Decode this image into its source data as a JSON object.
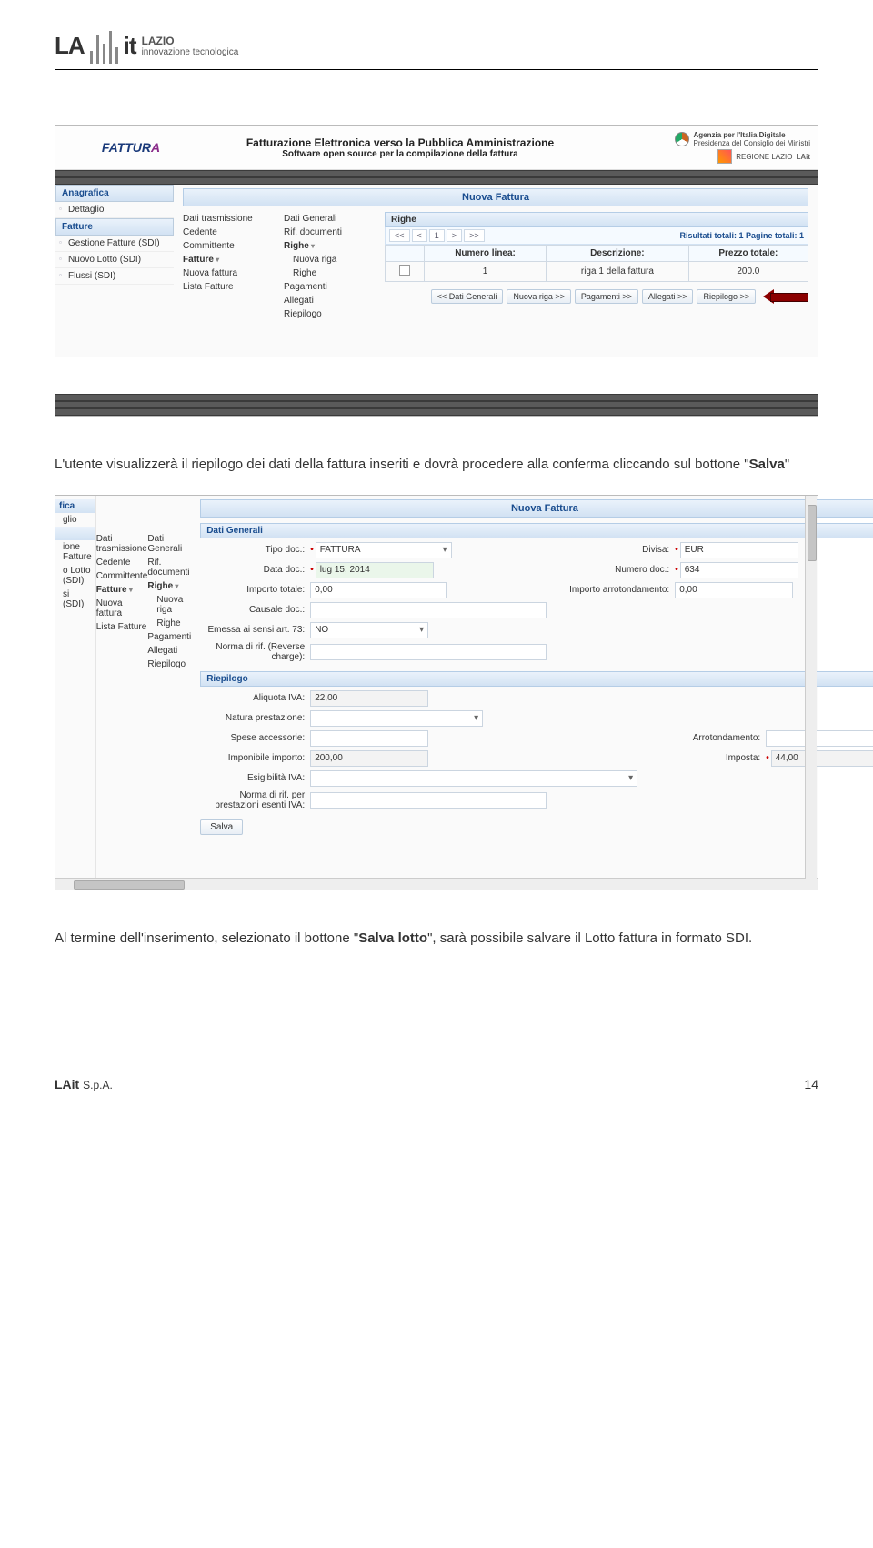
{
  "header": {
    "brand": "LA",
    "brand2": "it",
    "region": "LAZIO",
    "tagline": "innovazione tecnologica"
  },
  "text": {
    "para1": "L'utente visualizzerà il riepilogo dei dati della fattura inseriti e dovrà procedere alla conferma cliccando sul bottone \"",
    "para1_bold": "Salva",
    "para1_end": "\"",
    "para2a": "Al termine dell'inserimento, selezionato il bottone \"",
    "para2_bold": "Salva lotto",
    "para2b": "\", sarà possibile salvare il Lotto fattura in formato SDI."
  },
  "shot1": {
    "headerTitle": "Fatturazione Elettronica verso la Pubblica Amministrazione",
    "headerSub": "Software open source per la compilazione della fattura",
    "agid": "Agenzia per l'Italia Digitale",
    "agidSub": "Presidenza del Consiglio dei Ministri",
    "regione": "REGIONE LAZIO",
    "lait": "LAit",
    "sidebar": {
      "s1": "Anagrafica",
      "s1_items": [
        "Dettaglio"
      ],
      "s2": "Fatture",
      "s2_items": [
        "Gestione Fatture (SDI)",
        "Nuovo Lotto (SDI)",
        "Flussi (SDI)"
      ]
    },
    "subnav1": [
      "Dati trasmissione",
      "Cedente",
      "Committente",
      "Fatture",
      "Nuova fattura",
      "Lista Fatture"
    ],
    "subnav2": [
      "Dati Generali",
      "Rif. documenti",
      "Righe",
      "Nuova riga",
      "Righe",
      "Pagamenti",
      "Allegati",
      "Riepilogo"
    ],
    "panelTitle": "Nuova Fattura",
    "righeTitle": "Righe",
    "pager": {
      "b1": "<<",
      "b2": "<",
      "b3": "1",
      "b4": ">",
      "b5": ">>",
      "text": "Risultati totali: 1 Pagine totali: 1"
    },
    "tbl": {
      "h1": "Numero linea:",
      "h2": "Descrizione:",
      "h3": "Prezzo totale:",
      "r1c1": "1",
      "r1c2": "riga 1 della fattura",
      "r1c3": "200.0"
    },
    "navbtns": [
      "<< Dati Generali",
      "Nuova riga >>",
      "Pagamenti >>",
      "Allegati >>",
      "Riepilogo >>"
    ]
  },
  "shot2": {
    "panelTitle": "Nuova Fattura",
    "sidebar": {
      "h1": "fica",
      "i1": "glio",
      "h2": "",
      "items": [
        "ione Fatture",
        "o Lotto (SDI)",
        "si (SDI)"
      ]
    },
    "subnav1": [
      "Dati trasmissione",
      "Cedente",
      "Committente",
      "Fatture",
      "Nuova fattura",
      "Lista Fatture"
    ],
    "subnav2": [
      "Dati Generali",
      "Rif. documenti",
      "Righe",
      "Nuova riga",
      "Righe",
      "Pagamenti",
      "Allegati",
      "Riepilogo"
    ],
    "sect1": "Dati Generali",
    "form": {
      "tipoLbl": "Tipo doc.:",
      "tipoVal": "FATTURA",
      "divisaLbl": "Divisa:",
      "divisaVal": "EUR",
      "dataLbl": "Data doc.:",
      "dataVal": "lug 15, 2014",
      "numLbl": "Numero doc.:",
      "numVal": "634",
      "impTotLbl": "Importo totale:",
      "impTotVal": "0,00",
      "arrotLbl": "Importo arrotondamento:",
      "arrotVal": "0,00",
      "causaleLbl": "Causale doc.:",
      "art73Lbl": "Emessa ai sensi art. 73:",
      "art73Val": "NO",
      "revLbl": "Norma di rif. (Reverse charge):"
    },
    "sect2": "Riepilogo",
    "riep": {
      "aliqLbl": "Aliquota IVA:",
      "aliqVal": "22,00",
      "naturaLbl": "Natura prestazione:",
      "speseLbl": "Spese accessorie:",
      "arrotLbl": "Arrotondamento:",
      "imponLbl": "Imponibile importo:",
      "imponVal": "200,00",
      "impostaLbl": "Imposta:",
      "impostaVal": "44,00",
      "esigLbl": "Esigibilità IVA:",
      "normaLbl": "Norma di rif. per prestazioni esenti IVA:"
    },
    "salva": "Salva"
  },
  "footer": {
    "left": "LAit",
    "spa": "S.p.A.",
    "page": "14"
  }
}
